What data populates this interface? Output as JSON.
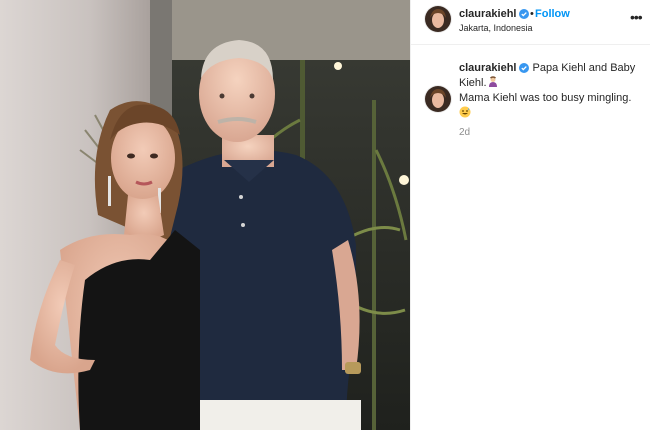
{
  "post": {
    "photo_alt": "",
    "header": {
      "username": "claurakiehl",
      "dot": "•",
      "follow_label": "Follow",
      "location": "Jakarta, Indonesia",
      "more_label": "•••"
    },
    "caption": {
      "username": "claurakiehl",
      "line1": "Papa Kiehl and Baby Kiehl.",
      "line2": "Mama Kiehl was too busy mingling.",
      "emojis": [
        "person-emoji",
        "grinning-sweat-emoji"
      ]
    },
    "timestamp": "2d"
  },
  "colors": {
    "follow": "#0095f6",
    "verified": "#3897f0",
    "muted": "#8e8e8e",
    "text": "#262626"
  }
}
